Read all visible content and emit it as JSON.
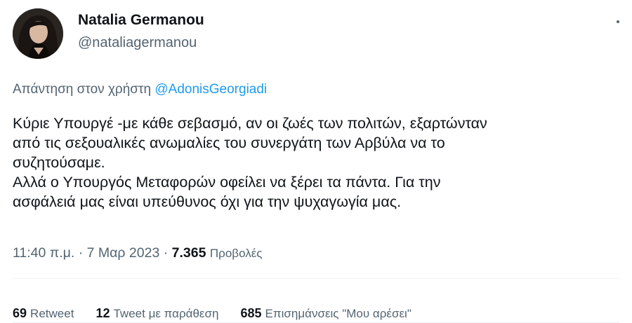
{
  "author": {
    "name": "Natalia Germanou",
    "handle": "@nataliagermanou"
  },
  "reply_to": {
    "prefix": "Απάντηση στον χρήστη",
    "mention": "@AdonisGeorgiadi"
  },
  "body_lines": [
    "Κύριε Υπουργέ -με κάθε σεβασμό, αν οι ζωές των πολιτών, εξαρτώνταν",
    "από τις σεξουαλικές ανωμαλίες του συνεργάτη των Αρβύλα να το",
    "συζητούσαμε.",
    "Αλλά ο Υπουργός Μεταφορών οφείλει να ξέρει τα πάντα. Για την",
    "ασφάλειά μας είναι υπεύθυνος όχι για την ψυχαγωγία μας."
  ],
  "meta": {
    "time": "11:40 π.μ.",
    "separator": "·",
    "date": "7 Μαρ 2023",
    "views_count": "7.365",
    "views_label": "Προβολές"
  },
  "stats": {
    "retweets": {
      "count": "69",
      "label": "Retweet"
    },
    "quotes": {
      "count": "12",
      "label": "Tweet με παράθεση"
    },
    "likes": {
      "count": "685",
      "label": "Επισημάνσεις \"Μου αρέσει\""
    }
  },
  "icons": {
    "more": "more-dots-icon"
  },
  "colors": {
    "text": "#0f1419",
    "secondary": "#536471",
    "link": "#1d9bf0",
    "divider": "#eff3f4"
  }
}
